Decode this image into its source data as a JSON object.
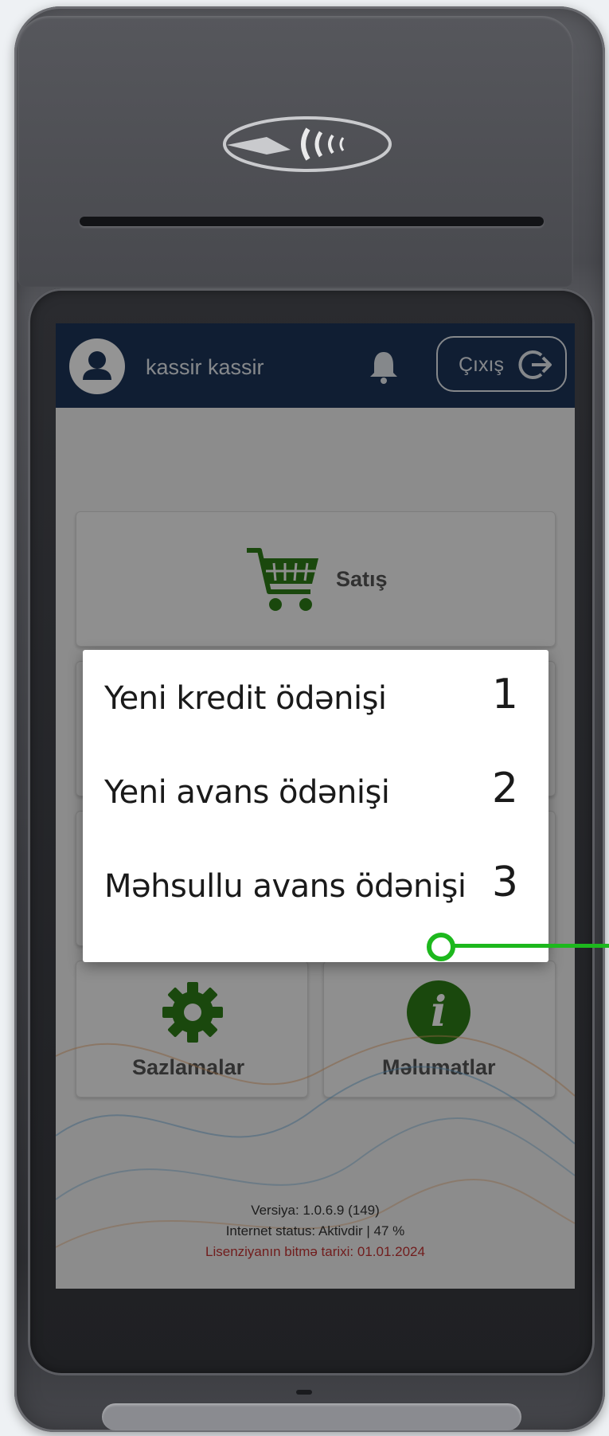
{
  "topbar": {
    "username": "kassir kassir",
    "logout_label": "Çıxış"
  },
  "tiles": {
    "sale_label": "Satış",
    "settings_label": "Sazlamalar",
    "info_label": "Məlumatlar",
    "info_icon_glyph": "i"
  },
  "footer": {
    "version": "Versiya: 1.0.6.9 (149)",
    "internet_status": "Internet status: Aktivdir | 47 %",
    "license_expiry": "Lisenziyanın bitmə tarixi: 01.01.2024"
  },
  "dialog": {
    "items": [
      {
        "label": "Yeni kredit ödənişi",
        "number": "1"
      },
      {
        "label": "Yeni avans ödənişi",
        "number": "2"
      },
      {
        "label": "Məhsullu avans ödənişi",
        "number": "3"
      }
    ]
  },
  "colors": {
    "topbar_bg": "#1d3458",
    "accent_green": "#2e7d17",
    "callout_green": "#1db81d",
    "license_red": "#c33333"
  },
  "icons": {
    "avatar": "user-avatar-icon",
    "bell": "bell-icon",
    "logout": "logout-icon",
    "cart": "shopping-cart-icon",
    "settings": "gear-icon",
    "info": "info-icon",
    "nfc": "contactless-icon"
  }
}
